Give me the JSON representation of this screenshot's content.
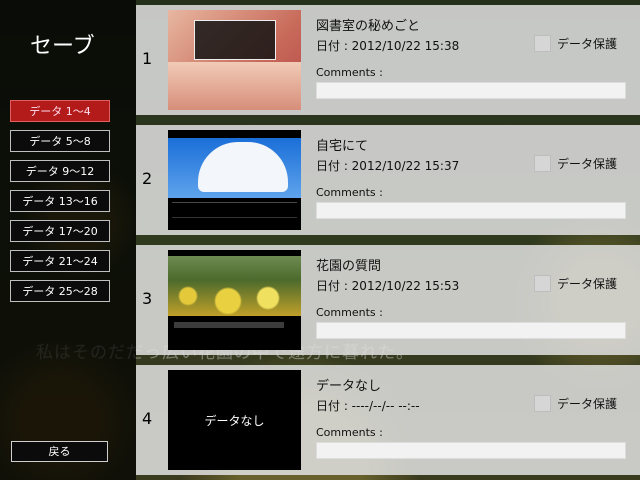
{
  "screen_title": "セーブ",
  "background_caption": "私はそのだだっ広い花園の中で途方に暮れた。",
  "nav": [
    {
      "label": "データ 1〜4",
      "active": true
    },
    {
      "label": "データ 5〜8",
      "active": false
    },
    {
      "label": "データ 9〜12",
      "active": false
    },
    {
      "label": "データ 13〜16",
      "active": false
    },
    {
      "label": "データ 17〜20",
      "active": false
    },
    {
      "label": "データ 21〜24",
      "active": false
    },
    {
      "label": "データ 25〜28",
      "active": false
    }
  ],
  "back_label": "戻る",
  "colors": {
    "active_tab": "#b31b1b",
    "panel": "#000000",
    "slot_bg": "#e1e1e1"
  },
  "slots": [
    {
      "number": "1",
      "title": "図書室の秘めごと",
      "date": "日付 : 2012/10/22 15:38",
      "protect_label": "データ保護",
      "comments_label": "Comments :",
      "thumb_text": ""
    },
    {
      "number": "2",
      "title": "自宅にて",
      "date": "日付 : 2012/10/22 15:37",
      "protect_label": "データ保護",
      "comments_label": "Comments :",
      "thumb_text": ""
    },
    {
      "number": "3",
      "title": "花園の質問",
      "date": "日付 : 2012/10/22 15:53",
      "protect_label": "データ保護",
      "comments_label": "Comments :",
      "thumb_text": ""
    },
    {
      "number": "4",
      "title": "データなし",
      "date": "日付 : ----/--/-- --:--",
      "protect_label": "データ保護",
      "comments_label": "Comments :",
      "thumb_text": "データなし"
    }
  ]
}
